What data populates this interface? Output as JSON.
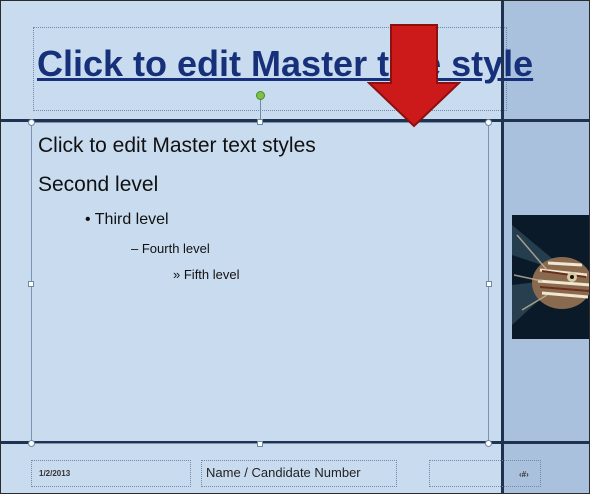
{
  "title": "Click to edit Master title style",
  "body_levels": [
    {
      "text": "Click to edit Master text styles",
      "bullet": ""
    },
    {
      "text": "Second level",
      "bullet": ""
    },
    {
      "text": "Third level",
      "bullet": "•"
    },
    {
      "text": "Fourth level",
      "bullet": "–"
    },
    {
      "text": "Fifth level",
      "bullet": "»"
    }
  ],
  "footer": {
    "date": "1/2/2013",
    "name": "Name / Candidate Number",
    "slide_number": "‹#›"
  },
  "colors": {
    "slide_bg": "#c9dbef",
    "side_panel": "#a9c1dd",
    "title_text": "#17307a",
    "guide_lines": "#1f3350",
    "arrow": "#cc1a1a"
  },
  "icons": {
    "arrow": "down-arrow-icon",
    "image": "lionfish-picture"
  }
}
